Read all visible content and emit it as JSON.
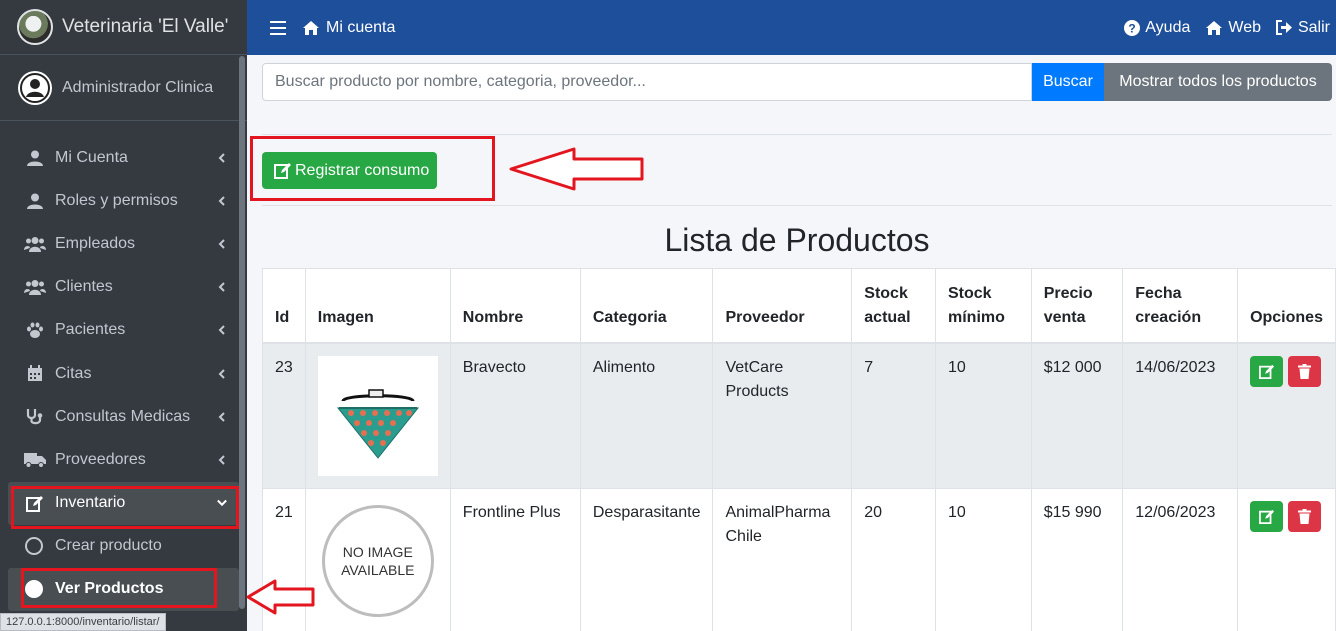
{
  "sidebar": {
    "brand": "Veterinaria 'El Valle'",
    "user": "Administrador Clinica",
    "items": [
      {
        "label": "Mi Cuenta",
        "icon": "user-icon"
      },
      {
        "label": "Roles y permisos",
        "icon": "user-icon"
      },
      {
        "label": "Empleados",
        "icon": "users-icon"
      },
      {
        "label": "Clientes",
        "icon": "users-icon"
      },
      {
        "label": "Pacientes",
        "icon": "paw-icon"
      },
      {
        "label": "Citas",
        "icon": "calendar-icon"
      },
      {
        "label": "Consultas Medicas",
        "icon": "stethoscope-icon"
      },
      {
        "label": "Proveedores",
        "icon": "truck-icon"
      },
      {
        "label": "Inventario",
        "icon": "edit-icon"
      }
    ],
    "subitems": [
      {
        "label": "Crear producto"
      },
      {
        "label": "Ver Productos"
      }
    ]
  },
  "status_url": "127.0.0.1:8000/inventario/listar/",
  "topbar": {
    "home": "Mi cuenta",
    "help": "Ayuda",
    "web": "Web",
    "logout": "Salir"
  },
  "search": {
    "placeholder": "Buscar producto por nombre, categoria, proveedor...",
    "button": "Buscar",
    "show_all": "Mostrar todos los productos"
  },
  "register_button": "Registrar consumo",
  "page_title": "Lista de Productos",
  "table": {
    "headers": [
      "Id",
      "Imagen",
      "Nombre",
      "Categoria",
      "Proveedor",
      "Stock actual",
      "Stock mínimo",
      "Precio venta",
      "Fecha creación",
      "Opciones"
    ],
    "header_lines": [
      [
        "Id"
      ],
      [
        "Imagen"
      ],
      [
        "Nombre"
      ],
      [
        "Categoria"
      ],
      [
        "Proveedor"
      ],
      [
        "Stock",
        "actual"
      ],
      [
        "Stock",
        "mínimo"
      ],
      [
        "Precio",
        "venta"
      ],
      [
        "Fecha",
        "creación"
      ],
      [
        "Opciones"
      ]
    ],
    "rows": [
      {
        "id": "23",
        "nombre": "Bravecto",
        "categoria": "Alimento",
        "proveedor": "VetCare Products",
        "stock_actual": "7",
        "stock_minimo": "10",
        "precio": "$12 000",
        "fecha": "14/06/2023",
        "image": "bandana"
      },
      {
        "id": "21",
        "nombre": "Frontline Plus",
        "categoria": "Desparasitante",
        "proveedor": "AnimalPharma Chile",
        "stock_actual": "20",
        "stock_minimo": "10",
        "precio": "$15 990",
        "fecha": "12/06/2023",
        "image_text_1": "NO IMAGE",
        "image_text_2": "AVAILABLE"
      }
    ]
  },
  "colors": {
    "sidebar": "#343a40",
    "topbar": "#1e4f9a",
    "primary": "#007bff",
    "success": "#28a745",
    "danger": "#dc3545",
    "secondary": "#6c757d",
    "annotation": "#e3161f"
  }
}
